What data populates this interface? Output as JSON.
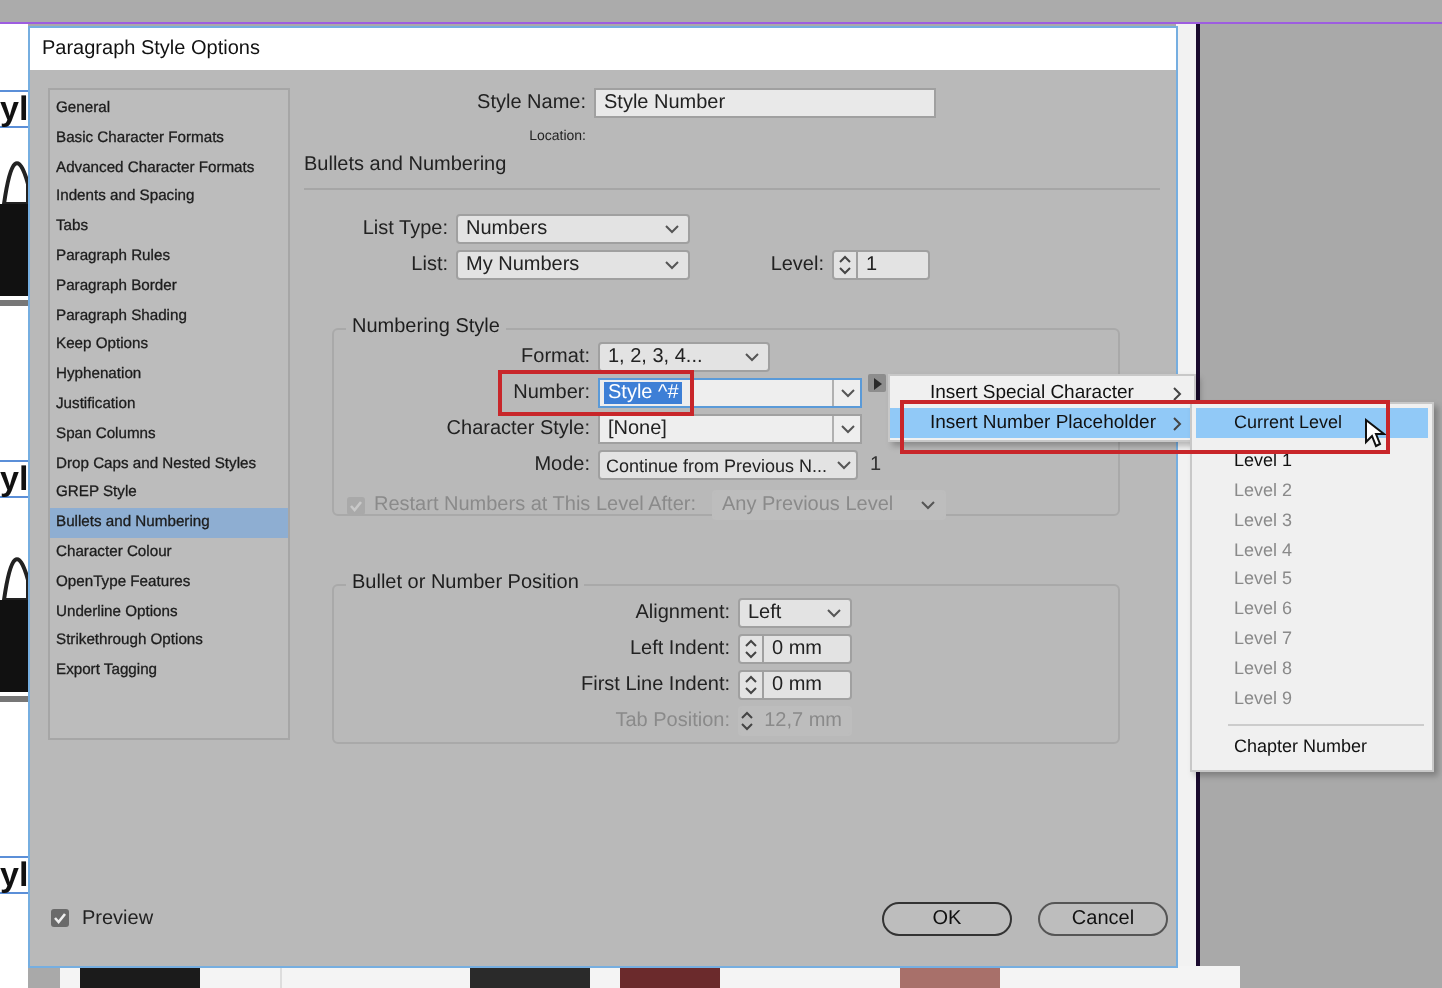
{
  "background": {
    "page_fragments": [
      "yl",
      "yl",
      "yl"
    ]
  },
  "dialog": {
    "title": "Paragraph Style Options"
  },
  "sidebar": {
    "items": [
      {
        "label": "General",
        "selected": false
      },
      {
        "label": "Basic Character Formats",
        "selected": false
      },
      {
        "label": "Advanced Character Formats",
        "selected": false
      },
      {
        "label": "Indents and Spacing",
        "selected": false
      },
      {
        "label": "Tabs",
        "selected": false
      },
      {
        "label": "Paragraph Rules",
        "selected": false
      },
      {
        "label": "Paragraph Border",
        "selected": false
      },
      {
        "label": "Paragraph Shading",
        "selected": false
      },
      {
        "label": "Keep Options",
        "selected": false
      },
      {
        "label": "Hyphenation",
        "selected": false
      },
      {
        "label": "Justification",
        "selected": false
      },
      {
        "label": "Span Columns",
        "selected": false
      },
      {
        "label": "Drop Caps and Nested Styles",
        "selected": false
      },
      {
        "label": "GREP Style",
        "selected": false
      },
      {
        "label": "Bullets and Numbering",
        "selected": true
      },
      {
        "label": "Character Colour",
        "selected": false
      },
      {
        "label": "OpenType Features",
        "selected": false
      },
      {
        "label": "Underline Options",
        "selected": false
      },
      {
        "label": "Strikethrough Options",
        "selected": false
      },
      {
        "label": "Export Tagging",
        "selected": false
      }
    ]
  },
  "style_name": {
    "label": "Style Name:",
    "value": "Style Number"
  },
  "location": {
    "label": "Location:"
  },
  "section_title": "Bullets and Numbering",
  "list_type": {
    "label": "List Type:",
    "value": "Numbers"
  },
  "list": {
    "label": "List:",
    "value": "My Numbers"
  },
  "level": {
    "label": "Level:",
    "value": "1"
  },
  "numbering_style": {
    "title": "Numbering Style",
    "format": {
      "label": "Format:",
      "value": "1, 2, 3, 4..."
    },
    "number": {
      "label": "Number:",
      "value": "Style ^#",
      "outlined": true
    },
    "character_style": {
      "label": "Character Style:",
      "value": "[None]"
    },
    "mode": {
      "label": "Mode:",
      "value": "Continue from Previous N...",
      "count": "1"
    },
    "restart": {
      "label": "Restart Numbers at This Level After:",
      "checked": true,
      "disabled": true,
      "value": "Any Previous Level"
    }
  },
  "position": {
    "title": "Bullet or Number Position",
    "alignment": {
      "label": "Alignment:",
      "value": "Left"
    },
    "left_indent": {
      "label": "Left Indent:",
      "value": "0 mm",
      "disabled": false
    },
    "first_line_indent": {
      "label": "First Line Indent:",
      "value": "0 mm",
      "disabled": false
    },
    "tab_position": {
      "label": "Tab Position:",
      "value": "12,7 mm",
      "disabled": true
    }
  },
  "preview": {
    "label": "Preview",
    "checked": true
  },
  "buttons": [
    {
      "label": "OK",
      "kind": "default"
    },
    {
      "label": "Cancel",
      "kind": "normal"
    }
  ],
  "menu": {
    "items": [
      {
        "label": "Insert Special Character",
        "selected": false,
        "outlined": false
      },
      {
        "label": "Insert Number Placeholder",
        "selected": true,
        "outlined": true
      }
    ]
  },
  "submenu": {
    "items": [
      {
        "label": "Current Level",
        "kind": "item",
        "selected": true,
        "disabled": false
      },
      {
        "label": "Level 1",
        "kind": "item",
        "selected": false,
        "disabled": false
      },
      {
        "label": "Level 2",
        "kind": "item",
        "selected": false,
        "disabled": true
      },
      {
        "label": "Level 3",
        "kind": "item",
        "selected": false,
        "disabled": true
      },
      {
        "label": "Level 4",
        "kind": "item",
        "selected": false,
        "disabled": true
      },
      {
        "label": "Level 5",
        "kind": "item",
        "selected": false,
        "disabled": true
      },
      {
        "label": "Level 6",
        "kind": "item",
        "selected": false,
        "disabled": true
      },
      {
        "label": "Level 7",
        "kind": "item",
        "selected": false,
        "disabled": true
      },
      {
        "label": "Level 8",
        "kind": "item",
        "selected": false,
        "disabled": true
      },
      {
        "label": "Level 9",
        "kind": "item",
        "selected": false,
        "disabled": true
      },
      {
        "label": "Chapter Number",
        "kind": "item-after-separator",
        "selected": false,
        "disabled": false
      }
    ]
  }
}
